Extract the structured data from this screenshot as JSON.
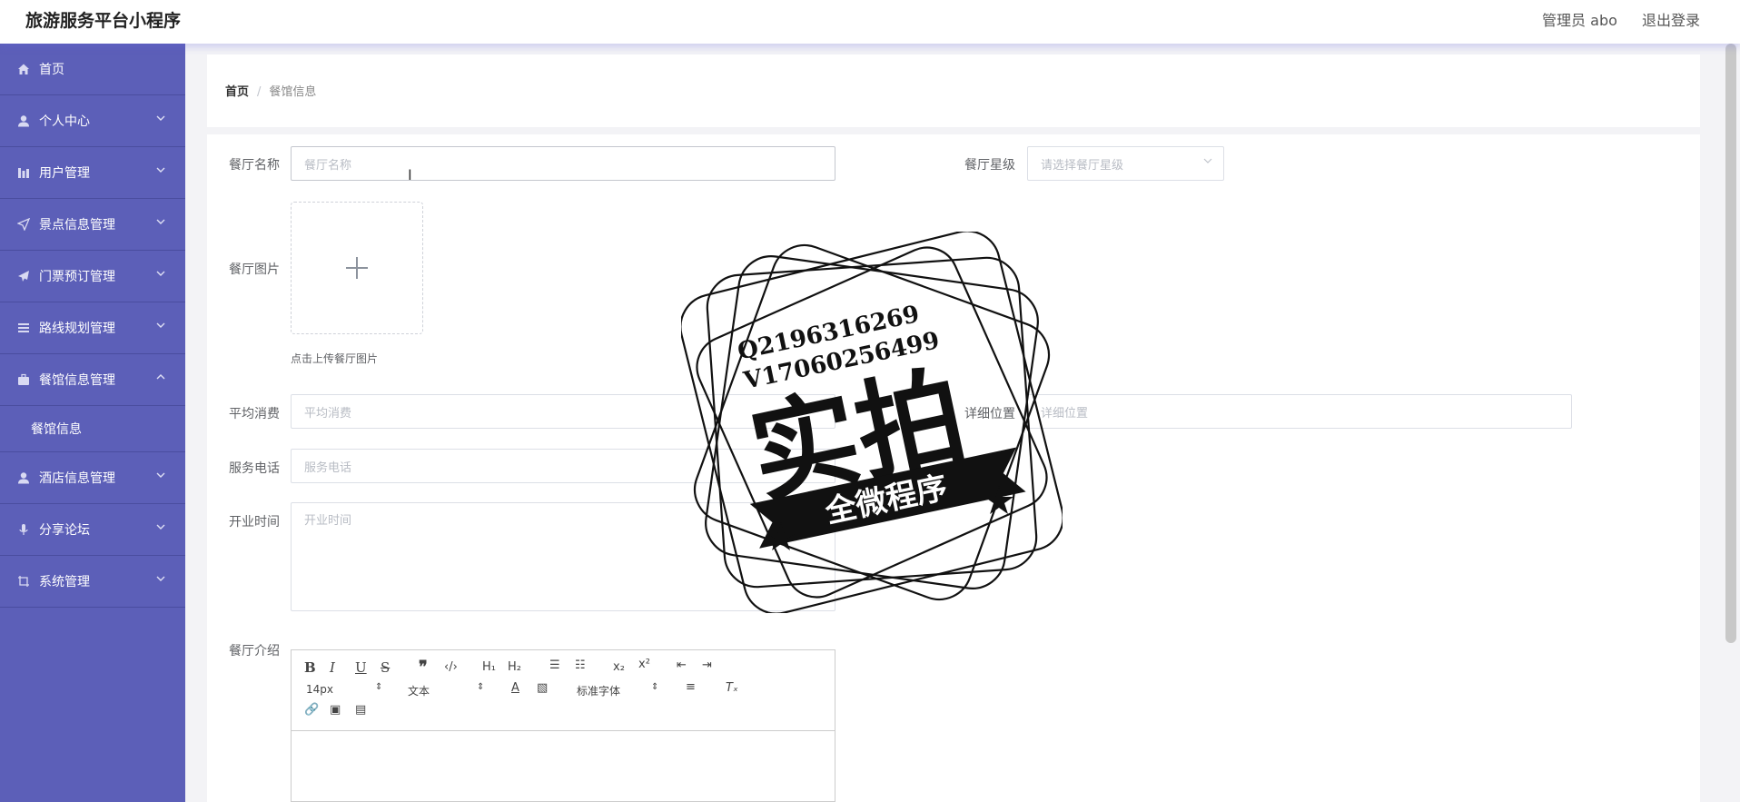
{
  "app": {
    "title": "旅游服务平台小程序"
  },
  "header": {
    "user_label": "管理员 abo",
    "logout_label": "退出登录"
  },
  "sidebar": {
    "items": [
      {
        "label": "首页",
        "icon": "home-icon",
        "expandable": false
      },
      {
        "label": "个人中心",
        "icon": "user-icon",
        "expandable": true
      },
      {
        "label": "用户管理",
        "icon": "chart-icon",
        "expandable": true
      },
      {
        "label": "景点信息管理",
        "icon": "location-arrow-icon",
        "expandable": true
      },
      {
        "label": "门票预订管理",
        "icon": "send-icon",
        "expandable": true
      },
      {
        "label": "路线规划管理",
        "icon": "list-icon",
        "expandable": true
      },
      {
        "label": "餐馆信息管理",
        "icon": "briefcase-icon",
        "expandable": true,
        "expanded": true
      },
      {
        "label": "酒店信息管理",
        "icon": "user-icon",
        "expandable": true
      },
      {
        "label": "分享论坛",
        "icon": "microphone-icon",
        "expandable": true
      },
      {
        "label": "系统管理",
        "icon": "crop-icon",
        "expandable": true
      }
    ],
    "submenu": {
      "label": "餐馆信息"
    }
  },
  "breadcrumb": {
    "home": "首页",
    "separator": "/",
    "current": "餐馆信息"
  },
  "form": {
    "name": {
      "label": "餐厅名称",
      "placeholder": "餐厅名称"
    },
    "star": {
      "label": "餐厅星级",
      "placeholder": "请选择餐厅星级"
    },
    "image": {
      "label": "餐厅图片",
      "hint": "点击上传餐厅图片"
    },
    "avg_cost": {
      "label": "平均消费",
      "placeholder": "平均消费"
    },
    "location": {
      "label": "详细位置",
      "placeholder": "详细位置"
    },
    "phone": {
      "label": "服务电话",
      "placeholder": "服务电话"
    },
    "hours": {
      "label": "开业时间",
      "placeholder": "开业时间"
    },
    "intro": {
      "label": "餐厅介绍"
    }
  },
  "editor_toolbar": {
    "font_size": "14px",
    "heading": "文本",
    "font_family": "标准字体",
    "buttons": [
      "bold-icon",
      "italic-icon",
      "underline-icon",
      "strike-icon",
      "quote-icon",
      "code-icon",
      "h1-icon",
      "h2-icon",
      "ordered-list-icon",
      "bullet-list-icon",
      "subscript-icon",
      "superscript-icon",
      "outdent-icon",
      "indent-icon",
      "font-color-icon",
      "background-color-icon",
      "align-icon",
      "clean-format-icon",
      "link-icon",
      "image-icon",
      "video-icon"
    ]
  },
  "watermark": {
    "line1": "Q2196316269",
    "line2": "V17060256499",
    "big": "实拍",
    "ribbon": "全微程序"
  },
  "colors": {
    "sidebar": "#5c5fb8",
    "sidebar_border": "#4a4d9f"
  }
}
